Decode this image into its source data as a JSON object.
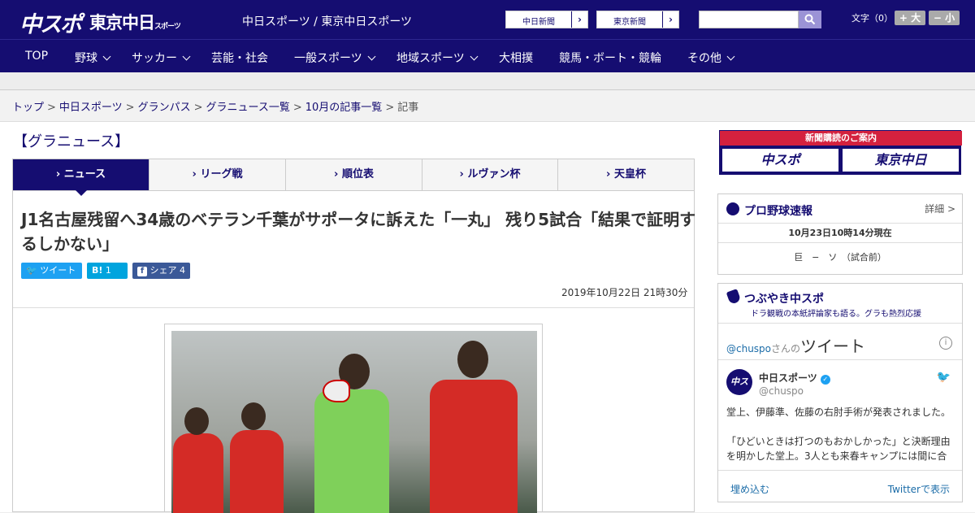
{
  "header": {
    "logo1": "中スポ",
    "logo2": "東京中日",
    "logo2_small": "スポーツ",
    "site_name": "中日スポーツ / 東京中日スポーツ",
    "link1": "中日新聞",
    "link2": "東京新聞",
    "font_label": "文字（0）",
    "font_big": "+ 大",
    "font_small": "− 小"
  },
  "nav": {
    "items": [
      "TOP",
      "野球",
      "サッカー",
      "芸能・社会",
      "一般スポーツ",
      "地域スポーツ",
      "大相撲",
      "競馬・ボート・競輪",
      "その他"
    ]
  },
  "breadcrumb": [
    "トップ",
    "中日スポーツ",
    "グランパス",
    "グラニュース一覧",
    "10月の記事一覧",
    "記事"
  ],
  "section_title": "【グラニュース】",
  "tabs": [
    "ニュース",
    "リーグ戦",
    "順位表",
    "ルヴァン杯",
    "天皇杯"
  ],
  "article": {
    "headline": "J1名古屋残留へ34歳のベテラン千葉がサポータに訴えた「一丸」 残り5試合「結果で証明するしかない」",
    "tweet_label": "ツイート",
    "hatena_label": "B!",
    "hatena_count": "1",
    "fb_label": "シェア",
    "fb_count": "4",
    "date": "2019年10月22日 21時30分"
  },
  "ad": {
    "top": "新聞購読のご案内",
    "left": "中スポ",
    "right": "東京中日"
  },
  "baseball": {
    "title": "プロ野球速報",
    "more": "詳細 >",
    "time": "10月23日10時14分現在",
    "game": "巨　−　ソ　（試合前）"
  },
  "tweets": {
    "title": "つぶやき中スポ",
    "subtitle": "ドラ観戦の本紙評論家も語る。グラも熱烈応援",
    "handle_label": "@chuspo",
    "handle_suffix": "さんの",
    "handle_big": "ツイート",
    "name": "中日スポーツ",
    "handle": "@chuspo",
    "avatar": "中スポ",
    "text1": "堂上、伊藤準、佐藤の右肘手術が発表されました。",
    "text2": "「ひどいときは打つのもおかしかった」と決断理由を明かした堂上。3人とも来春キャンプには間に合",
    "embed": "埋め込む",
    "view": "Twitterで表示"
  }
}
